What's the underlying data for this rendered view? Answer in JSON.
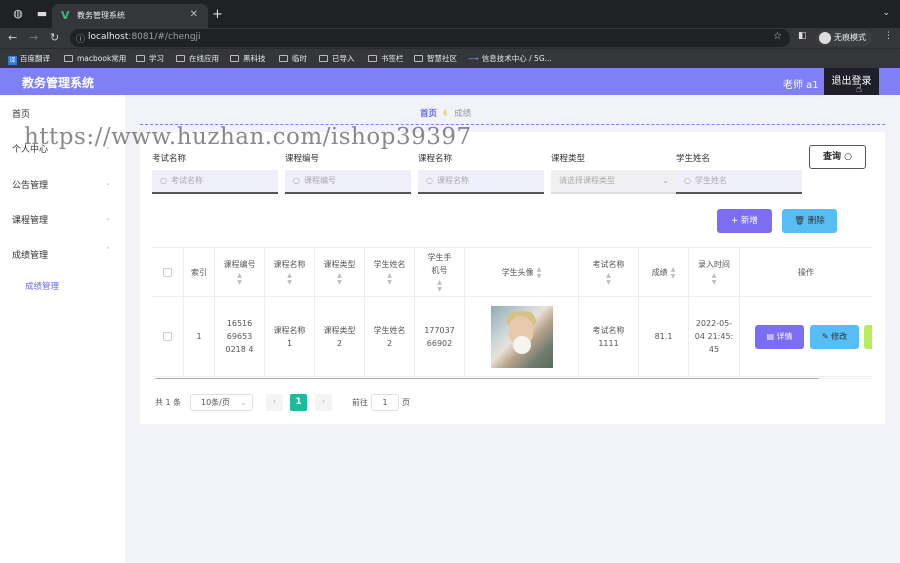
{
  "browser": {
    "tab_title": "教务管理系统",
    "url_host": "localhost",
    "url_rest": ":8081/#/chengji",
    "incognito_label": "无痕模式",
    "bookmarks": [
      "百度翻译",
      "macbook常用",
      "学习",
      "在线应用",
      "黑科技",
      "临时",
      "已导入",
      "书签栏",
      "智慧社区",
      "信息技术中心 / 5G..."
    ]
  },
  "app": {
    "title": "教务管理系统",
    "user_label": "老师 a1",
    "logout_label": "退出登录"
  },
  "sidebar": {
    "items": [
      {
        "label": "首页"
      },
      {
        "label": "个人中心"
      },
      {
        "label": "公告管理"
      },
      {
        "label": "课程管理"
      },
      {
        "label": "成绩管理"
      }
    ],
    "sub_items": [
      {
        "label": "成绩管理"
      }
    ]
  },
  "breadcrumb": {
    "home": "首页",
    "current": "成绩"
  },
  "watermark": "https://www.huzhan.com/ishop39397",
  "filters": [
    {
      "label": "考试名称",
      "placeholder": "考试名称"
    },
    {
      "label": "课程编号",
      "placeholder": "课程编号"
    },
    {
      "label": "课程名称",
      "placeholder": "课程名称"
    },
    {
      "label": "课程类型",
      "placeholder": "请选择课程类型"
    },
    {
      "label": "学生姓名",
      "placeholder": "学生姓名"
    }
  ],
  "buttons": {
    "query": "查询",
    "add": "新增",
    "delete": "删除"
  },
  "table": {
    "headers": [
      "索引",
      "课程编号",
      "课程名称",
      "课程类型",
      "学生姓名",
      "学生手机号",
      "学生头像",
      "考试名称",
      "成绩",
      "录入时间",
      "操作"
    ],
    "rows": [
      {
        "index": "1",
        "course_no": "16516696530218 4",
        "course_name": "课程名称1",
        "course_type": "课程类型2",
        "student_name": "学生姓名2",
        "phone": "17703766902",
        "exam_name": "考试名称1111",
        "score": "81.1",
        "entry_time": "2022-05-04 21:45:45"
      }
    ],
    "actions": {
      "detail": "详情",
      "edit": "修改"
    }
  },
  "pagination": {
    "total": "共 1 条",
    "page_size": "10条/页",
    "current_page": "1",
    "goto_label": "前往",
    "goto_value": "1",
    "page_suffix": "页"
  },
  "colors": {
    "accent": "#7f7ff6",
    "add_button": "#7b6ef2",
    "delete_button": "#58bdf2",
    "edit_button": "#58bdf2",
    "page_current": "#1abc9c"
  }
}
